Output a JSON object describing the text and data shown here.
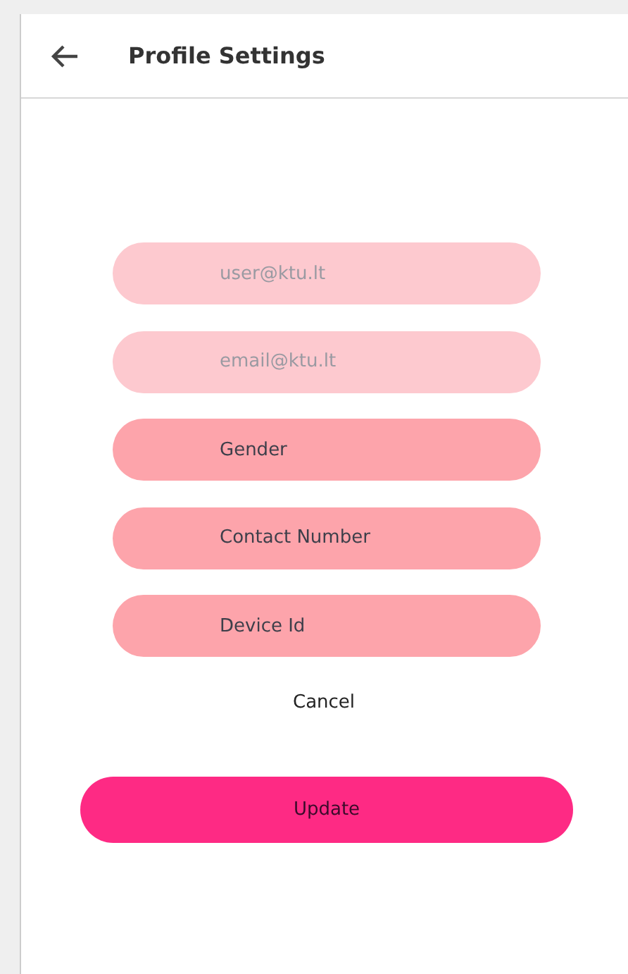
{
  "header": {
    "title": "Profile Settings"
  },
  "fields": [
    {
      "placeholder": "user@ktu.lt",
      "disabled": true
    },
    {
      "placeholder": "email@ktu.lt",
      "disabled": true
    },
    {
      "placeholder": "Gender",
      "disabled": false
    },
    {
      "placeholder": "Contact Number",
      "disabled": false
    },
    {
      "placeholder": "Device Id",
      "disabled": false
    }
  ],
  "cancel": "Cancel",
  "update": "Update"
}
